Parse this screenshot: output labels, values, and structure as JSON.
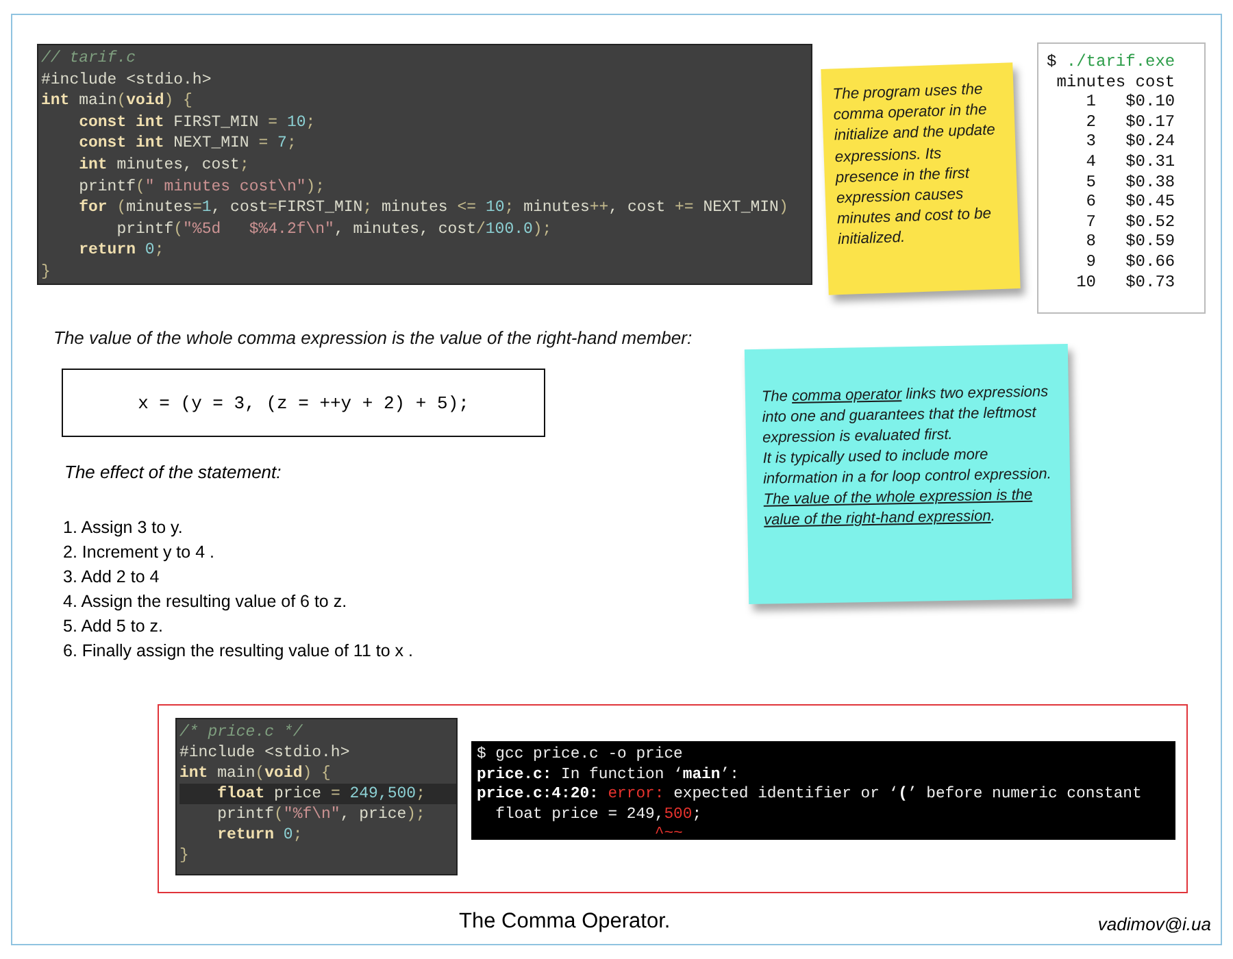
{
  "top_code": {
    "lines": [
      {
        "tokens": [
          {
            "t": "// tarif.c",
            "kind": "cmt"
          }
        ]
      },
      {
        "tokens": [
          {
            "t": "#include <stdio.h>",
            "kind": "plain"
          }
        ]
      },
      {
        "tokens": [
          {
            "t": "int",
            "kind": "kw"
          },
          {
            "t": " main",
            "kind": "plain"
          },
          {
            "t": "(",
            "kind": "op"
          },
          {
            "t": "void",
            "kind": "kw"
          },
          {
            "t": ") {",
            "kind": "op"
          }
        ]
      },
      {
        "tokens": [
          {
            "t": "    const int",
            "kind": "kw"
          },
          {
            "t": " FIRST_MIN ",
            "kind": "plain"
          },
          {
            "t": "=",
            "kind": "op"
          },
          {
            "t": " 10",
            "kind": "num"
          },
          {
            "t": ";",
            "kind": "op"
          }
        ]
      },
      {
        "tokens": [
          {
            "t": "    const int",
            "kind": "kw"
          },
          {
            "t": " NEXT_MIN ",
            "kind": "plain"
          },
          {
            "t": "=",
            "kind": "op"
          },
          {
            "t": " 7",
            "kind": "num"
          },
          {
            "t": ";",
            "kind": "op"
          }
        ]
      },
      {
        "tokens": [
          {
            "t": "    int",
            "kind": "kw"
          },
          {
            "t": " minutes, cost",
            "kind": "plain"
          },
          {
            "t": ";",
            "kind": "op"
          }
        ]
      },
      {
        "tokens": [
          {
            "t": "    printf",
            "kind": "plain"
          },
          {
            "t": "(",
            "kind": "op"
          },
          {
            "t": "\" minutes cost\\n\"",
            "kind": "str"
          },
          {
            "t": ");",
            "kind": "op"
          }
        ]
      },
      {
        "tokens": [
          {
            "t": "    for",
            "kind": "kw"
          },
          {
            "t": " (",
            "kind": "op"
          },
          {
            "t": "minutes",
            "kind": "plain"
          },
          {
            "t": "=",
            "kind": "op"
          },
          {
            "t": "1",
            "kind": "num"
          },
          {
            "t": ", cost",
            "kind": "plain"
          },
          {
            "t": "=",
            "kind": "op"
          },
          {
            "t": "FIRST_MIN",
            "kind": "plain"
          },
          {
            "t": ";",
            "kind": "op"
          },
          {
            "t": " minutes ",
            "kind": "plain"
          },
          {
            "t": "<=",
            "kind": "op"
          },
          {
            "t": " 10",
            "kind": "num"
          },
          {
            "t": ";",
            "kind": "op"
          },
          {
            "t": " minutes",
            "kind": "plain"
          },
          {
            "t": "++",
            "kind": "op"
          },
          {
            "t": ", cost ",
            "kind": "plain"
          },
          {
            "t": "+=",
            "kind": "op"
          },
          {
            "t": " NEXT_MIN",
            "kind": "plain"
          },
          {
            "t": ")",
            "kind": "op"
          }
        ]
      },
      {
        "tokens": [
          {
            "t": "        printf",
            "kind": "plain"
          },
          {
            "t": "(",
            "kind": "op"
          },
          {
            "t": "\"%5d   $%4.2f\\n\"",
            "kind": "str"
          },
          {
            "t": ", minutes, cost",
            "kind": "plain"
          },
          {
            "t": "/",
            "kind": "op"
          },
          {
            "t": "100.0",
            "kind": "num"
          },
          {
            "t": ");",
            "kind": "op"
          }
        ]
      },
      {
        "tokens": [
          {
            "t": "    return",
            "kind": "kw"
          },
          {
            "t": " 0",
            "kind": "num"
          },
          {
            "t": ";",
            "kind": "op"
          }
        ]
      },
      {
        "tokens": [
          {
            "t": "}",
            "kind": "op"
          }
        ]
      }
    ]
  },
  "yellow_note": {
    "text": "The program uses the comma operator in the initialize and the update expressions. Its presence in the first expression causes minutes and cost to be initialized."
  },
  "program_output": {
    "lines": [
      {
        "tokens": [
          {
            "t": "$ ",
            "kind": "plain"
          },
          {
            "t": "./tarif.exe",
            "kind": "accent"
          }
        ]
      },
      {
        "tokens": [
          {
            "t": " minutes cost",
            "kind": "plain"
          }
        ]
      },
      {
        "tokens": [
          {
            "t": "    1   $0.10",
            "kind": "plain"
          }
        ]
      },
      {
        "tokens": [
          {
            "t": "    2   $0.17",
            "kind": "plain"
          }
        ]
      },
      {
        "tokens": [
          {
            "t": "    3   $0.24",
            "kind": "plain"
          }
        ]
      },
      {
        "tokens": [
          {
            "t": "    4   $0.31",
            "kind": "plain"
          }
        ]
      },
      {
        "tokens": [
          {
            "t": "    5   $0.38",
            "kind": "plain"
          }
        ]
      },
      {
        "tokens": [
          {
            "t": "    6   $0.45",
            "kind": "plain"
          }
        ]
      },
      {
        "tokens": [
          {
            "t": "    7   $0.52",
            "kind": "plain"
          }
        ]
      },
      {
        "tokens": [
          {
            "t": "    8   $0.59",
            "kind": "plain"
          }
        ]
      },
      {
        "tokens": [
          {
            "t": "    9   $0.66",
            "kind": "plain"
          }
        ]
      },
      {
        "tokens": [
          {
            "t": "   10   $0.73",
            "kind": "plain"
          }
        ]
      }
    ]
  },
  "statement": "The value of the whole comma expression is the value of the right-hand member:",
  "expression": "x = (y = 3, (z = ++y + 2) + 5);",
  "effect_title": "The effect of the statement:",
  "steps": [
    "1. Assign 3 to y.",
    "2. Increment y to 4 .",
    "3. Add 2 to 4",
    "4. Assign the resulting value of 6 to z.",
    "5. Add 5 to z.",
    "6. Finally assign the resulting value of 11 to x ."
  ],
  "cyan_note": {
    "paragraphs": [
      {
        "segments": [
          {
            "text": "The ",
            "underline": false
          },
          {
            "text": "comma operator",
            "underline": true
          },
          {
            "text": " links two expressions into one and guarantees that the leftmost expression is evaluated first.",
            "underline": false
          }
        ]
      },
      {
        "segments": [
          {
            "text": "It is typically used to include more information in a for loop control expression. ",
            "underline": false
          },
          {
            "text": "The value of the whole expression is the value of the right-hand expression",
            "underline": true
          },
          {
            "text": ".",
            "underline": false
          }
        ]
      }
    ]
  },
  "bottom_code": {
    "lines": [
      {
        "highlighted": false,
        "tokens": [
          {
            "t": "/* price.c */",
            "kind": "cmt"
          }
        ]
      },
      {
        "highlighted": false,
        "tokens": [
          {
            "t": "#include <stdio.h>",
            "kind": "plain"
          }
        ]
      },
      {
        "highlighted": false,
        "tokens": [
          {
            "t": "int",
            "kind": "kw"
          },
          {
            "t": " main",
            "kind": "plain"
          },
          {
            "t": "(",
            "kind": "op"
          },
          {
            "t": "void",
            "kind": "kw"
          },
          {
            "t": ") {",
            "kind": "op"
          }
        ]
      },
      {
        "highlighted": true,
        "tokens": [
          {
            "t": "    float",
            "kind": "kw"
          },
          {
            "t": " price ",
            "kind": "plain"
          },
          {
            "t": "=",
            "kind": "op"
          },
          {
            "t": " 249,500",
            "kind": "num"
          },
          {
            "t": ";",
            "kind": "op"
          }
        ]
      },
      {
        "highlighted": false,
        "tokens": [
          {
            "t": "    printf",
            "kind": "plain"
          },
          {
            "t": "(",
            "kind": "op"
          },
          {
            "t": "\"%f\\n\"",
            "kind": "str"
          },
          {
            "t": ", price",
            "kind": "plain"
          },
          {
            "t": ");",
            "kind": "op"
          }
        ]
      },
      {
        "highlighted": false,
        "tokens": [
          {
            "t": "    return",
            "kind": "kw"
          },
          {
            "t": " 0",
            "kind": "num"
          },
          {
            "t": ";",
            "kind": "op"
          }
        ]
      },
      {
        "highlighted": false,
        "tokens": [
          {
            "t": "}",
            "kind": "op"
          }
        ]
      }
    ]
  },
  "compiler_output": {
    "lines": [
      {
        "tokens": [
          {
            "t": "$ gcc price.c -o price",
            "kind": "plain"
          }
        ]
      },
      {
        "tokens": [
          {
            "t": "price.c:",
            "kind": "bold"
          },
          {
            "t": " In function ‘",
            "kind": "plain"
          },
          {
            "t": "main",
            "kind": "bold"
          },
          {
            "t": "’:",
            "kind": "plain"
          }
        ]
      },
      {
        "tokens": [
          {
            "t": "price.c:4:20:",
            "kind": "bold"
          },
          {
            "t": " error:",
            "kind": "error"
          },
          {
            "t": " expected identifier or ‘",
            "kind": "plain"
          },
          {
            "t": "(",
            "kind": "bold"
          },
          {
            "t": "’ before numeric constant",
            "kind": "plain"
          }
        ]
      },
      {
        "tokens": [
          {
            "t": "  float price = 249,",
            "kind": "plain"
          },
          {
            "t": "500",
            "kind": "error"
          },
          {
            "t": ";",
            "kind": "plain"
          }
        ]
      },
      {
        "tokens": [
          {
            "t": "                   ^~~",
            "kind": "error"
          }
        ]
      }
    ]
  },
  "caption": "The Comma Operator.",
  "author": "vadimov@i.ua"
}
